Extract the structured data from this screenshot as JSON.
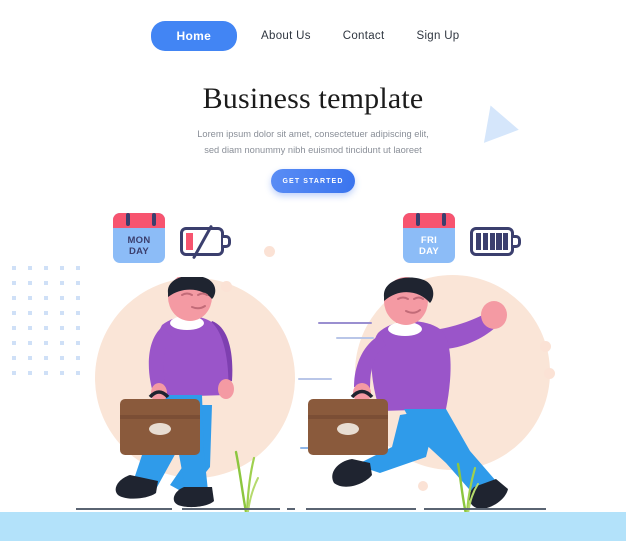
{
  "nav": {
    "items": [
      {
        "label": "Home",
        "active": true
      },
      {
        "label": "About Us",
        "active": false
      },
      {
        "label": "Contact",
        "active": false
      },
      {
        "label": "Sign Up",
        "active": false
      }
    ]
  },
  "hero": {
    "title": "Business template",
    "subtitle_line1": "Lorem ipsum dolor sit amet, consectetuer adipiscing elit,",
    "subtitle_line2": "sed diam nonummy nibh euismod tincidunt ut laoreet",
    "cta_label": "GET STARTED"
  },
  "illustration": {
    "left": {
      "calendar": {
        "day_line1": "MON",
        "day_line2": "DAY",
        "header_color": "#f7546f",
        "body_color": "#8cbcf7",
        "text_color": "#3b3f6e"
      },
      "battery": {
        "state": "empty-disabled",
        "bars": 1,
        "bar_color": "#f7546f",
        "outline_color": "#3b3f6e",
        "slashed": true
      }
    },
    "right": {
      "calendar": {
        "day_line1": "FRI",
        "day_line2": "DAY",
        "header_color": "#f7546f",
        "body_color": "#8cbcf7",
        "text_color": "#ffffff"
      },
      "battery": {
        "state": "full",
        "bars": 5,
        "bar_color": "#3b3f6e",
        "outline_color": "#3b3f6e",
        "slashed": false
      }
    }
  },
  "colors": {
    "accent_blue": "#4285f4",
    "sweater_purple": "#9a55c9",
    "pants_blue": "#2f9bea",
    "briefcase_brown": "#8a5a3c",
    "skin": "#f49aa3",
    "hair_dark": "#1f2430",
    "circle_peach": "#fae5d7",
    "ground_blue": "#b3e2fa",
    "navy": "#3b3f6e",
    "dot_grid": "#cfe0f7",
    "triangle": "#d5e6fb",
    "grass_green": "#8cc63f"
  }
}
